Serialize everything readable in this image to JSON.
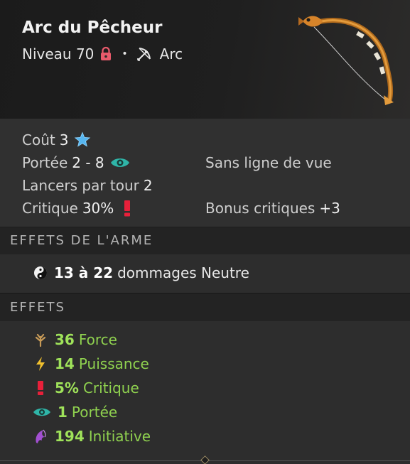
{
  "item": {
    "name": "Arc du Pêcheur",
    "level_label": "Niveau 70",
    "separator": "•",
    "type": "Arc",
    "icons": {
      "lock": "lock-icon",
      "type": "bow-icon",
      "art": "fishing-bow-illustration"
    }
  },
  "stats": {
    "cost_label": "Coût",
    "cost_value": "3",
    "range_label": "Portée",
    "range_value": "2 - 8",
    "los_text": "Sans ligne de vue",
    "casts_label": "Lancers par tour",
    "casts_value": "2",
    "crit_label": "Critique",
    "crit_value": "30%",
    "crit_bonus_label": "Bonus critiques",
    "crit_bonus_value": "+3"
  },
  "weapon_effects": {
    "heading": "EFFETS DE L'ARME",
    "damage_range": "13 à 22",
    "damage_text": "dommages Neutre"
  },
  "effects": {
    "heading": "EFFETS",
    "items": [
      {
        "value": "36",
        "label": "Force",
        "icon": "strength-icon"
      },
      {
        "value": "14",
        "label": "Puissance",
        "icon": "power-icon"
      },
      {
        "value": "5%",
        "label": "Critique",
        "icon": "critical-icon"
      },
      {
        "value": "1",
        "label": "Portée",
        "icon": "range-eye-icon"
      },
      {
        "value": "194",
        "label": "Initiative",
        "icon": "initiative-icon"
      }
    ]
  },
  "colors": {
    "effect_green": "#8fd14f",
    "accent_red": "#e8203a",
    "range_teal": "#2fb5a8",
    "ap_blue": "#56b6f0"
  }
}
